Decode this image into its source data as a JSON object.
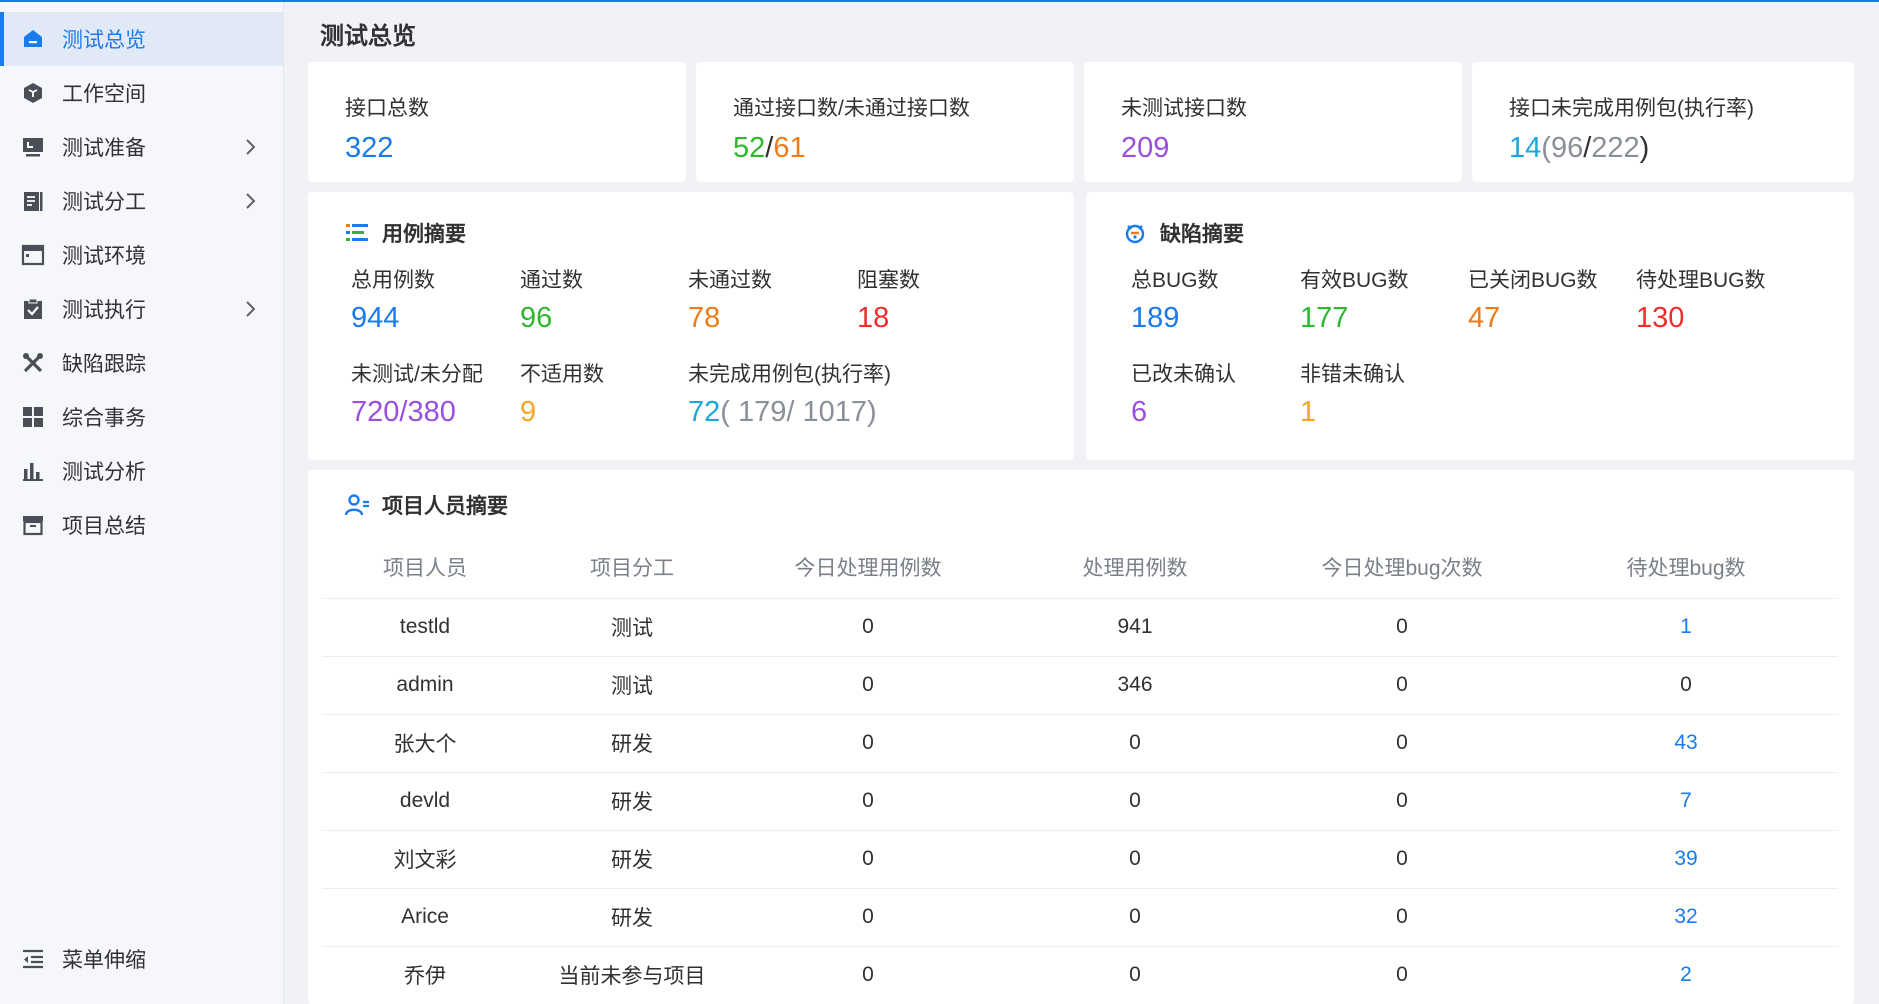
{
  "sidebar": {
    "items": [
      {
        "label": "测试总览",
        "icon": "home-icon",
        "active": true,
        "expandable": false
      },
      {
        "label": "工作空间",
        "icon": "cube-icon",
        "active": false,
        "expandable": false
      },
      {
        "label": "测试准备",
        "icon": "monitor-icon",
        "active": false,
        "expandable": true
      },
      {
        "label": "测试分工",
        "icon": "document-icon",
        "active": false,
        "expandable": true
      },
      {
        "label": "测试环境",
        "icon": "window-icon",
        "active": false,
        "expandable": false
      },
      {
        "label": "测试执行",
        "icon": "clipboard-check-icon",
        "active": false,
        "expandable": true
      },
      {
        "label": "缺陷跟踪",
        "icon": "tools-icon",
        "active": false,
        "expandable": false
      },
      {
        "label": "综合事务",
        "icon": "grid-icon",
        "active": false,
        "expandable": false
      },
      {
        "label": "测试分析",
        "icon": "bar-chart-icon",
        "active": false,
        "expandable": false
      },
      {
        "label": "项目总结",
        "icon": "archive-icon",
        "active": false,
        "expandable": false
      }
    ],
    "collapse_label": "菜单伸缩"
  },
  "page": {
    "title": "测试总览"
  },
  "stats": {
    "total_api": {
      "label": "接口总数",
      "value": "322"
    },
    "pass_fail_api": {
      "label": "通过接口数/未通过接口数",
      "pass": "52",
      "sep": "/",
      "fail": "61"
    },
    "untested_api": {
      "label": "未测试接口数",
      "value": "209"
    },
    "api_incomplete": {
      "label": "接口未完成用例包(执行率)",
      "value": "14",
      "open": "(",
      "done": "96",
      "sep": "/",
      "total": "222",
      "close": ")"
    }
  },
  "case_summary": {
    "title": "用例摘要",
    "total": {
      "label": "总用例数",
      "value": "944"
    },
    "passed": {
      "label": "通过数",
      "value": "96"
    },
    "failed": {
      "label": "未通过数",
      "value": "78"
    },
    "blocked": {
      "label": "阻塞数",
      "value": "18"
    },
    "untested": {
      "label": "未测试/未分配",
      "value": "720/380"
    },
    "na": {
      "label": "不适用数",
      "value": "9"
    },
    "incomplete": {
      "label": "未完成用例包(执行率)",
      "value": "72",
      "rest": "( 179/ 1017)"
    }
  },
  "bug_summary": {
    "title": "缺陷摘要",
    "total": {
      "label": "总BUG数",
      "value": "189"
    },
    "valid": {
      "label": "有效BUG数",
      "value": "177"
    },
    "closed": {
      "label": "已关闭BUG数",
      "value": "47"
    },
    "pending": {
      "label": "待处理BUG数",
      "value": "130"
    },
    "fixed_unconfirmed": {
      "label": "已改未确认",
      "value": "6"
    },
    "notbug_unconfirmed": {
      "label": "非错未确认",
      "value": "1"
    }
  },
  "staff": {
    "title": "项目人员摘要",
    "columns": [
      "项目人员",
      "项目分工",
      "今日处理用例数",
      "处理用例数",
      "今日处理bug次数",
      "待处理bug数"
    ],
    "rows": [
      {
        "name": "testld",
        "role": "测试",
        "today_cases": "0",
        "cases": "941",
        "today_bugs": "0",
        "pending_bugs": "1",
        "link": true
      },
      {
        "name": "admin",
        "role": "测试",
        "today_cases": "0",
        "cases": "346",
        "today_bugs": "0",
        "pending_bugs": "0",
        "link": false
      },
      {
        "name": "张大个",
        "role": "研发",
        "today_cases": "0",
        "cases": "0",
        "today_bugs": "0",
        "pending_bugs": "43",
        "link": true
      },
      {
        "name": "devld",
        "role": "研发",
        "today_cases": "0",
        "cases": "0",
        "today_bugs": "0",
        "pending_bugs": "7",
        "link": true
      },
      {
        "name": "刘文彩",
        "role": "研发",
        "today_cases": "0",
        "cases": "0",
        "today_bugs": "0",
        "pending_bugs": "39",
        "link": true
      },
      {
        "name": "Arice",
        "role": "研发",
        "today_cases": "0",
        "cases": "0",
        "today_bugs": "0",
        "pending_bugs": "32",
        "link": true
      },
      {
        "name": "乔伊",
        "role": "当前未参与项目",
        "today_cases": "0",
        "cases": "0",
        "today_bugs": "0",
        "pending_bugs": "2",
        "link": true
      }
    ]
  },
  "colors": {
    "accent": "#1a7bea",
    "green": "#2fb82f",
    "orange": "#f07a18",
    "red": "#f02d2d",
    "purple": "#9b4fe0",
    "cyan": "#19a8d8",
    "yellow": "#f5a623",
    "gray": "#8a8f99"
  }
}
